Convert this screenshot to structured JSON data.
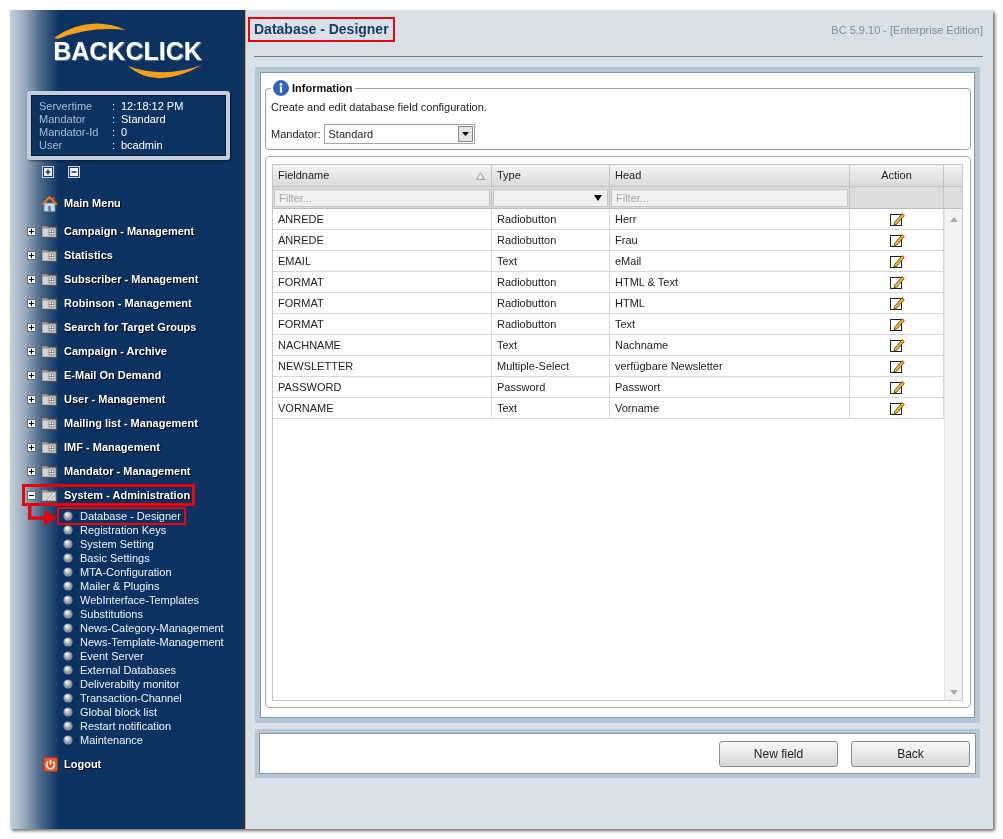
{
  "sidebar": {
    "logo": "BACKCLICK",
    "server_info": [
      {
        "label": "Servertime",
        "separator": ":",
        "value": "12:18:12 PM"
      },
      {
        "label": "Mandator",
        "separator": ":",
        "value": "Standard"
      },
      {
        "label": "Mandator-Id",
        "separator": ":",
        "value": "0"
      },
      {
        "label": "User",
        "separator": ":",
        "value": "bcadmin"
      }
    ],
    "main_menu": {
      "label": "Main Menu"
    },
    "menu": [
      {
        "label": "Campaign - Management",
        "kind": "folder",
        "expanded": false,
        "highlighted": false
      },
      {
        "label": "Statistics",
        "kind": "folder",
        "expanded": false,
        "highlighted": false
      },
      {
        "label": "Subscriber - Management",
        "kind": "folder",
        "expanded": false,
        "highlighted": false
      },
      {
        "label": "Robinson - Management",
        "kind": "folder",
        "expanded": false,
        "highlighted": false
      },
      {
        "label": "Search for Target Groups",
        "kind": "folder",
        "expanded": false,
        "highlighted": false
      },
      {
        "label": "Campaign - Archive",
        "kind": "folder",
        "expanded": false,
        "highlighted": false
      },
      {
        "label": "E-Mail On Demand",
        "kind": "folder",
        "expanded": false,
        "highlighted": false
      },
      {
        "label": "User - Management",
        "kind": "folder",
        "expanded": false,
        "highlighted": false
      },
      {
        "label": "Mailing list - Management",
        "kind": "folder",
        "expanded": false,
        "highlighted": false
      },
      {
        "label": "IMF - Management",
        "kind": "folder",
        "expanded": false,
        "highlighted": false
      },
      {
        "label": "Mandator - Management",
        "kind": "folder",
        "expanded": false,
        "highlighted": false
      },
      {
        "label": "System - Administration",
        "kind": "tools",
        "expanded": true,
        "highlighted": true,
        "children": [
          {
            "label": "Database - Designer",
            "highlighted": true,
            "arrow": true
          },
          {
            "label": "Registration Keys",
            "highlighted": false,
            "arrow": false
          },
          {
            "label": "System Setting",
            "highlighted": false,
            "arrow": false
          },
          {
            "label": "Basic Settings",
            "highlighted": false,
            "arrow": false
          },
          {
            "label": "MTA-Configuration",
            "highlighted": false,
            "arrow": false
          },
          {
            "label": "Mailer & Plugins",
            "highlighted": false,
            "arrow": false
          },
          {
            "label": "WebInterface-Templates",
            "highlighted": false,
            "arrow": false
          },
          {
            "label": "Substitutions",
            "highlighted": false,
            "arrow": false
          },
          {
            "label": "News-Category-Management",
            "highlighted": false,
            "arrow": false
          },
          {
            "label": "News-Template-Management",
            "highlighted": false,
            "arrow": false
          },
          {
            "label": "Event Server",
            "highlighted": false,
            "arrow": false
          },
          {
            "label": "External Databases",
            "highlighted": false,
            "arrow": false
          },
          {
            "label": "Deliverabilty monitor",
            "highlighted": false,
            "arrow": false
          },
          {
            "label": "Transaction-Channel",
            "highlighted": false,
            "arrow": false
          },
          {
            "label": "Global block list",
            "highlighted": false,
            "arrow": false
          },
          {
            "label": "Restart notification",
            "highlighted": false,
            "arrow": false
          },
          {
            "label": "Maintenance",
            "highlighted": false,
            "arrow": false
          }
        ]
      }
    ],
    "logout": {
      "label": "Logout"
    }
  },
  "header": {
    "title": {
      "text": "Database - Designer",
      "highlighted": true
    },
    "version": "BC 5.9.10 - [Enterprise Edition]"
  },
  "information": {
    "legend": "Information",
    "description": "Create and edit database field configuration.",
    "mandator_label": "Mandator:",
    "mandator_value": "Standard"
  },
  "table": {
    "columns": [
      {
        "label": "Fieldname",
        "kind": "text",
        "sorted": true,
        "filter": {
          "kind": "text",
          "placeholder": "Filter..."
        }
      },
      {
        "label": "Type",
        "kind": "text",
        "sorted": false,
        "filter": {
          "kind": "select"
        }
      },
      {
        "label": "Head",
        "kind": "text",
        "sorted": false,
        "filter": {
          "kind": "text",
          "placeholder": "Filter..."
        }
      },
      {
        "label": "Action",
        "kind": "action",
        "sorted": false
      }
    ],
    "rows": [
      {
        "cells": [
          "ANREDE",
          "Radiobutton",
          "Herr"
        ]
      },
      {
        "cells": [
          "ANREDE",
          "Radiobutton",
          "Frau"
        ]
      },
      {
        "cells": [
          "EMAIL",
          "Text",
          "eMail"
        ]
      },
      {
        "cells": [
          "FORMAT",
          "Radiobutton",
          "HTML & Text"
        ]
      },
      {
        "cells": [
          "FORMAT",
          "Radiobutton",
          "HTML"
        ]
      },
      {
        "cells": [
          "FORMAT",
          "Radiobutton",
          "Text"
        ]
      },
      {
        "cells": [
          "NACHNAME",
          "Text",
          "Nachname"
        ]
      },
      {
        "cells": [
          "NEWSLETTER",
          "Multiple-Select",
          "verfügbare Newsletter"
        ]
      },
      {
        "cells": [
          "PASSWORD",
          "Password",
          "Passwort"
        ]
      },
      {
        "cells": [
          "VORNAME",
          "Text",
          "Vorname"
        ]
      }
    ]
  },
  "buttons": [
    {
      "label": "New field"
    },
    {
      "label": "Back"
    }
  ]
}
